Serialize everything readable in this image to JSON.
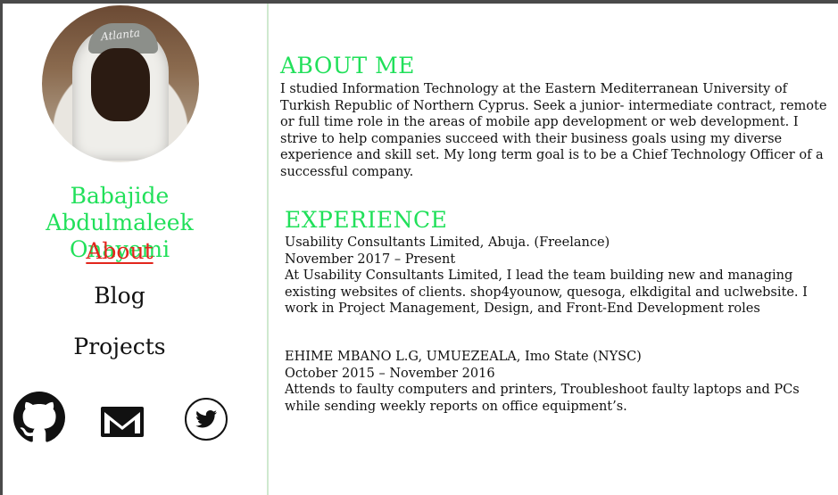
{
  "profile": {
    "name": "Babajide Abdulmaleek Onayemi",
    "avatar_cap_text": "Atlanta"
  },
  "nav": {
    "items": [
      {
        "label": "About",
        "active": true
      },
      {
        "label": "Blog",
        "active": false
      },
      {
        "label": "Projects",
        "active": false
      }
    ]
  },
  "social": {
    "icons": [
      "github-icon",
      "mail-icon",
      "twitter-icon"
    ]
  },
  "about": {
    "heading": "ABOUT ME",
    "text": "I studied Information Technology at the Eastern Mediterranean University of Turkish Republic of Northern Cyprus. Seek a junior- intermediate contract, remote or full time role in the areas of mobile app development or web development. I strive to help companies succeed with their business goals using my diverse experience and skill set. My long term goal is to be a Chief Technology Officer of a successful company."
  },
  "experience": {
    "heading": "EXPERIENCE",
    "jobs": [
      {
        "company": "Usability Consultants Limited, Abuja. (Freelance)",
        "dates": "November 2017 – Present",
        "description": "At Usability Consultants Limited, I lead the team building new and managing existing websites of clients. shop4younow, quesoga, elkdigital and uclwebsite. I work in Project Management, Design, and Front-End Development roles"
      },
      {
        "company": "EHIME MBANO L.G, UMUEZEALA, Imo State (NYSC)",
        "dates": "October 2015 – November 2016",
        "description": "Attends to faulty computers and printers, Troubleshoot faulty laptops and PCs while sending weekly reports on office equipment’s."
      }
    ]
  },
  "colors": {
    "accent_green": "#21e05a",
    "active_nav_red": "#e2261d",
    "text": "#111111"
  }
}
